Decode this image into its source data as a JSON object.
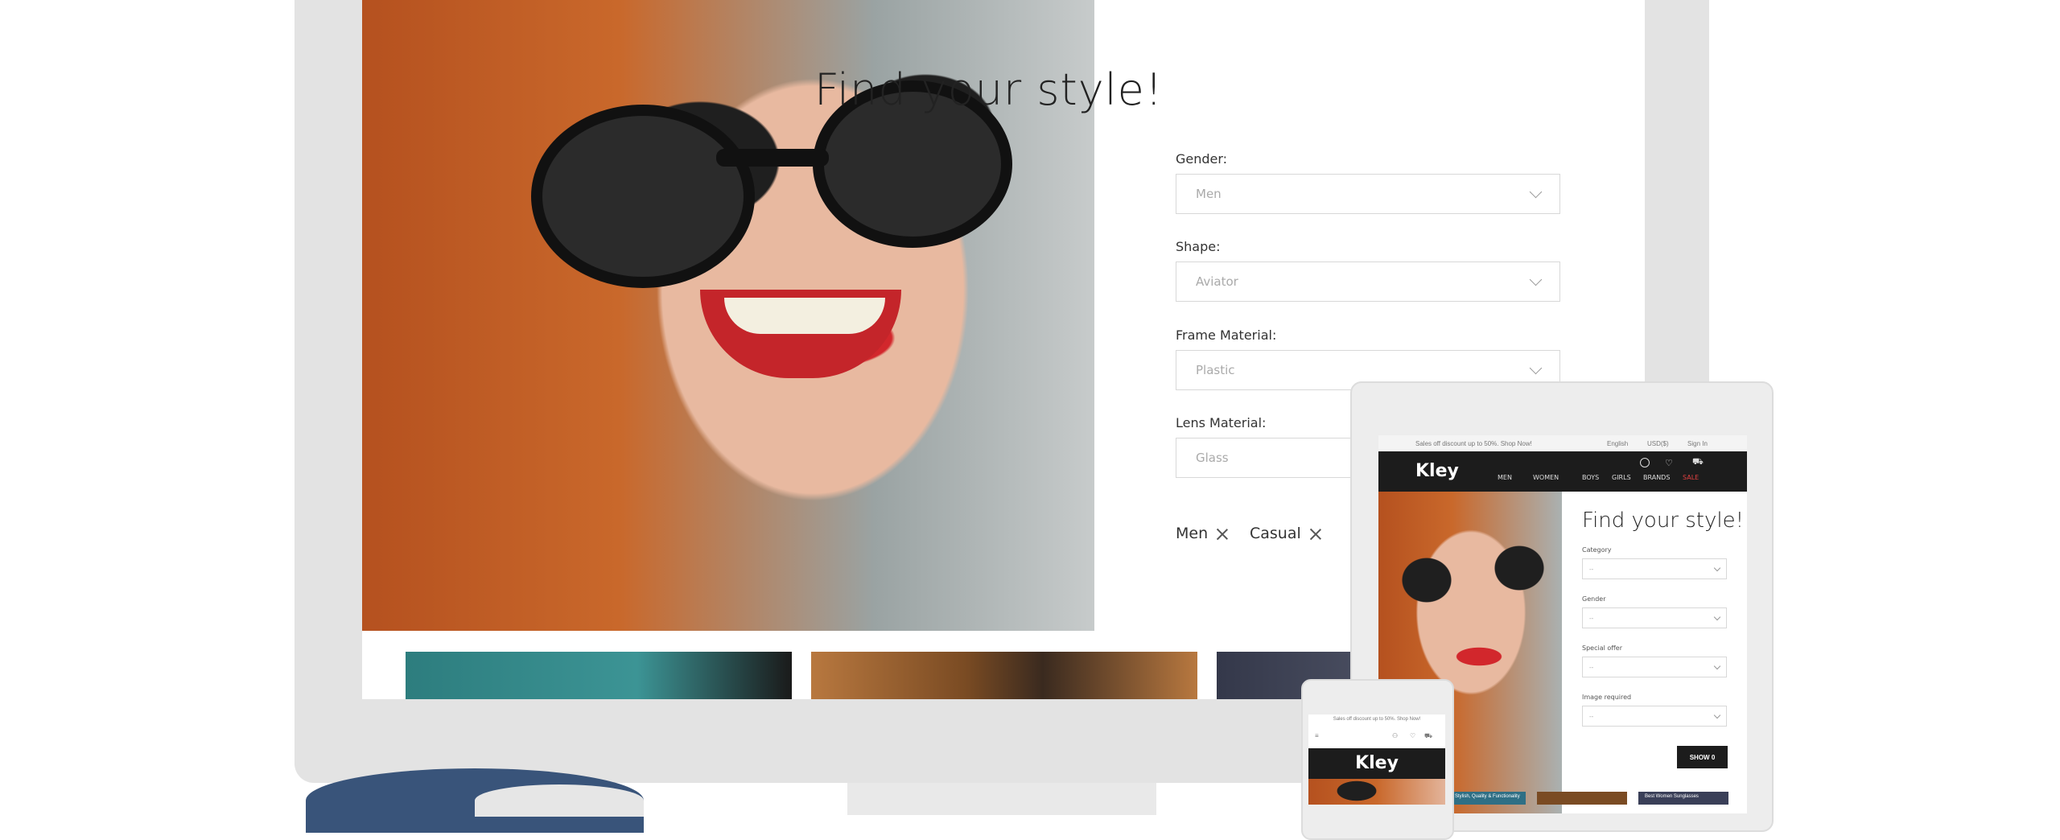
{
  "desktop": {
    "title": "Find your style!",
    "fields": [
      {
        "label": "Gender:",
        "value": "Men"
      },
      {
        "label": "Shape:",
        "value": "Aviator"
      },
      {
        "label": "Frame Material:",
        "value": "Plastic"
      },
      {
        "label": "Lens Material:",
        "value": "Glass"
      }
    ],
    "tags": [
      "Men",
      "Casual"
    ]
  },
  "tablet": {
    "topbar": {
      "promo": "Sales off discount up to 50%. Shop Now!",
      "language": "English",
      "currency": "USD($)",
      "signin": "Sign In"
    },
    "logo": "Kley",
    "nav": [
      "MEN",
      "WOMEN",
      "BOYS",
      "GIRLS",
      "BRANDS",
      "SALE"
    ],
    "sale_color": "#e04040",
    "title": "Find your style!",
    "fields": [
      {
        "label": "Category",
        "value": "--"
      },
      {
        "label": "Gender",
        "value": "--"
      },
      {
        "label": "Special offer",
        "value": "--"
      },
      {
        "label": "Image required",
        "value": "--"
      }
    ],
    "button": "SHOW 0",
    "bottom_captions": [
      "Stylish, Quality & Functionality",
      "Best Women Sunglasses"
    ]
  },
  "phone": {
    "promo": "Sales off discount up to 50%. Shop Now!",
    "logo": "Kley"
  },
  "colors": {
    "bezel": "#e3e3e3",
    "nav_dark": "#1c1c1c",
    "accent_sale": "#e04040"
  }
}
